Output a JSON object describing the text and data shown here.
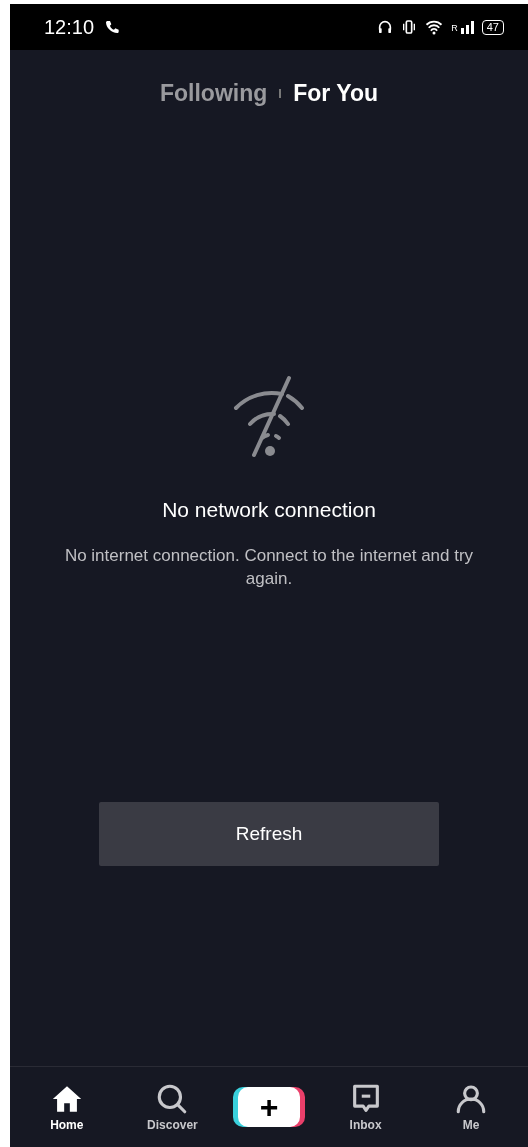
{
  "status_bar": {
    "time": "12:10",
    "network_label": "R",
    "battery": "47"
  },
  "tabs": [
    {
      "label": "Following",
      "selected": false
    },
    {
      "label": "For You",
      "selected": true
    }
  ],
  "empty_state": {
    "title": "No network connection",
    "message": "No internet connection. Connect to the internet and try again.",
    "button": "Refresh"
  },
  "nav": [
    {
      "kind": "home",
      "label": "Home",
      "selected": true
    },
    {
      "kind": "discover",
      "label": "Discover",
      "selected": false
    },
    {
      "kind": "create",
      "label": "+",
      "selected": false
    },
    {
      "kind": "inbox",
      "label": "Inbox",
      "selected": false
    },
    {
      "kind": "me",
      "label": "Me",
      "selected": false
    }
  ]
}
